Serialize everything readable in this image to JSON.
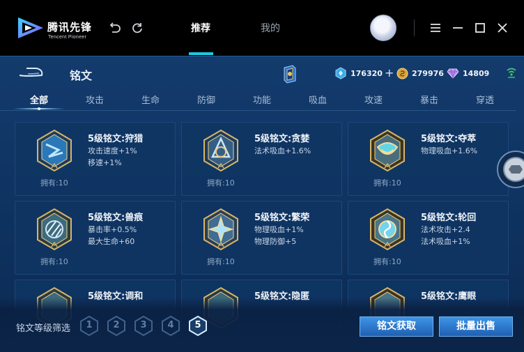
{
  "app": {
    "brand_cn": "腾讯先锋",
    "brand_en": "Tencent Pioneer",
    "tabs": [
      {
        "label": "推荐",
        "active": true
      },
      {
        "label": "我的",
        "active": false
      }
    ]
  },
  "panel": {
    "title": "铭文",
    "currencies": [
      {
        "icon": "diamond-coupon-icon",
        "value": "176320"
      },
      {
        "icon": "gold-coin-icon",
        "value": "279976"
      },
      {
        "icon": "purple-gem-icon",
        "value": "14809"
      }
    ],
    "categories": [
      "全部",
      "攻击",
      "生命",
      "防御",
      "功能",
      "吸血",
      "攻速",
      "暴击",
      "穿透"
    ],
    "active_category": 0
  },
  "cards": [
    {
      "name": "5级铭文:狩猎",
      "attrs": [
        "攻击速度+1%",
        "移速+1%"
      ],
      "owned": "拥有:10"
    },
    {
      "name": "5级铭文:贪婪",
      "attrs": [
        "法术吸血+1.6%",
        ""
      ],
      "owned": "拥有:10"
    },
    {
      "name": "5级铭文:夺萃",
      "attrs": [
        "物理吸血+1.6%",
        ""
      ],
      "owned": "拥有:10"
    },
    {
      "name": "5级铭文:兽痕",
      "attrs": [
        "暴击率+0.5%",
        "最大生命+60"
      ],
      "owned": "拥有:10"
    },
    {
      "name": "5级铭文:繁荣",
      "attrs": [
        "物理吸血+1%",
        "物理防御+5"
      ],
      "owned": "拥有:10"
    },
    {
      "name": "5级铭文:轮回",
      "attrs": [
        "法术攻击+2.4",
        "法术吸血+1%"
      ],
      "owned": "拥有:10"
    },
    {
      "name": "5级铭文:调和",
      "attrs": [
        "",
        ""
      ],
      "owned": ""
    },
    {
      "name": "5级铭文:隐匿",
      "attrs": [
        "",
        ""
      ],
      "owned": ""
    },
    {
      "name": "5级铭文:鹰眼",
      "attrs": [
        "",
        ""
      ],
      "owned": ""
    }
  ],
  "filter": {
    "label": "铭文等级筛选",
    "levels": [
      "1",
      "2",
      "3",
      "4",
      "5"
    ],
    "active_level": "5"
  },
  "actions": {
    "get_label": "铭文获取",
    "sell_label": "批量出售"
  },
  "colors": {
    "accent": "#1ec8e6",
    "panel_bg": "#0f3463",
    "button": "#2a79d0"
  }
}
